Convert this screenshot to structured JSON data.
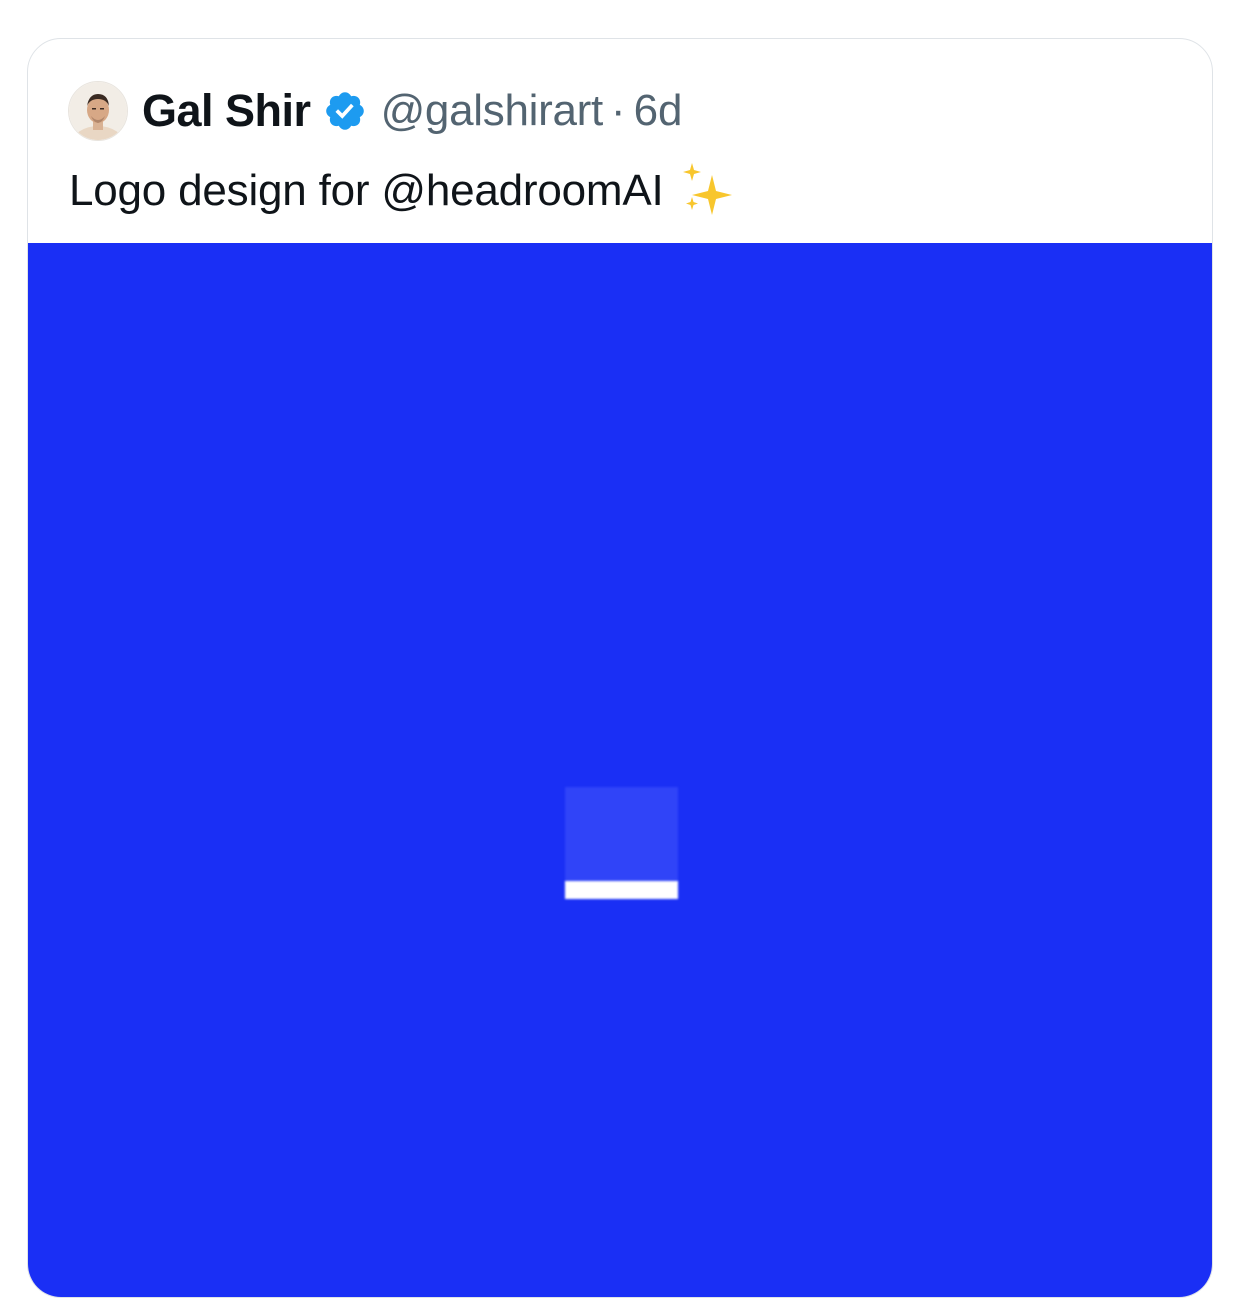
{
  "tweet": {
    "author": {
      "name": "Gal Shir",
      "handle": "@galshirart",
      "verified_icon": "verified-badge-icon",
      "avatar_icon": "avatar-photo"
    },
    "separator": "·",
    "timestamp": "6d",
    "text": "Logo design for @headroomAI",
    "emoji_icon": "sparkles-icon",
    "media": {
      "background_color": "#1a2ff5",
      "logo_square_color": "#3044f8",
      "logo_bar_color": "#ffffff"
    }
  },
  "colors": {
    "text_primary": "#0f1419",
    "text_secondary": "#536471",
    "verified_blue": "#1d9bf0",
    "card_border": "#dfe3e7"
  }
}
